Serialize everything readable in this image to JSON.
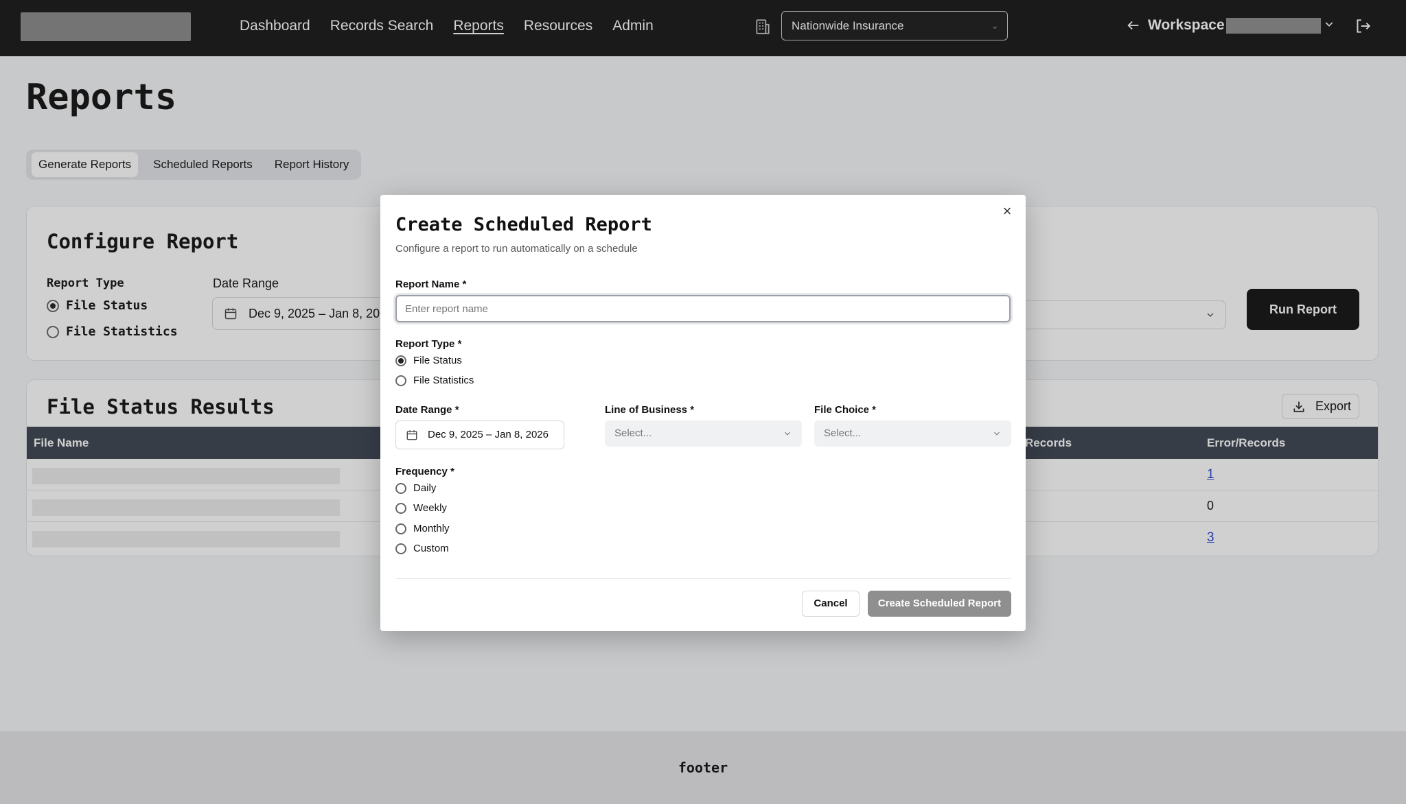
{
  "nav": {
    "items": [
      "Dashboard",
      "Records Search",
      "Reports",
      "Resources",
      "Admin"
    ],
    "active": "Reports",
    "org_select": "Nationwide Insurance",
    "workspace_label": "Workspace"
  },
  "page": {
    "title": "Reports",
    "tabs": [
      "Generate Reports",
      "Scheduled Reports",
      "Report History"
    ]
  },
  "configure": {
    "title": "Configure Report",
    "report_type_label": "Report Type",
    "options": [
      "File Status",
      "File Statistics"
    ],
    "selected": "File Status",
    "date_range_label": "Date Range",
    "date_range_value": "Dec 9, 2025 – Jan 8, 2026",
    "run_button": "Run Report"
  },
  "results": {
    "title": "File Status Results",
    "export_button": "Export",
    "columns": [
      "File Name",
      "Records",
      "Error/Records"
    ],
    "rows": [
      {
        "error_records": "1",
        "link": true
      },
      {
        "error_records": "0",
        "link": false
      },
      {
        "error_records": "3",
        "link": true
      }
    ]
  },
  "footer": {
    "text": "footer"
  },
  "modal": {
    "title": "Create Scheduled Report",
    "subtitle": "Configure a report to run automatically on a schedule",
    "report_name_label": "Report Name *",
    "report_name_placeholder": "Enter report name",
    "report_type_label": "Report Type *",
    "report_type_options": [
      "File Status",
      "File Statistics"
    ],
    "report_type_selected": "File Status",
    "date_range_label": "Date Range *",
    "date_range_value": "Dec 9, 2025 – Jan 8, 2026",
    "line_of_business_label": "Line of Business *",
    "line_of_business_placeholder": "Select...",
    "file_choice_label": "File Choice *",
    "file_choice_placeholder": "Select...",
    "frequency_label": "Frequency *",
    "frequency_options": [
      "Daily",
      "Weekly",
      "Monthly",
      "Custom"
    ],
    "cancel_button": "Cancel",
    "create_button": "Create Scheduled Report"
  }
}
